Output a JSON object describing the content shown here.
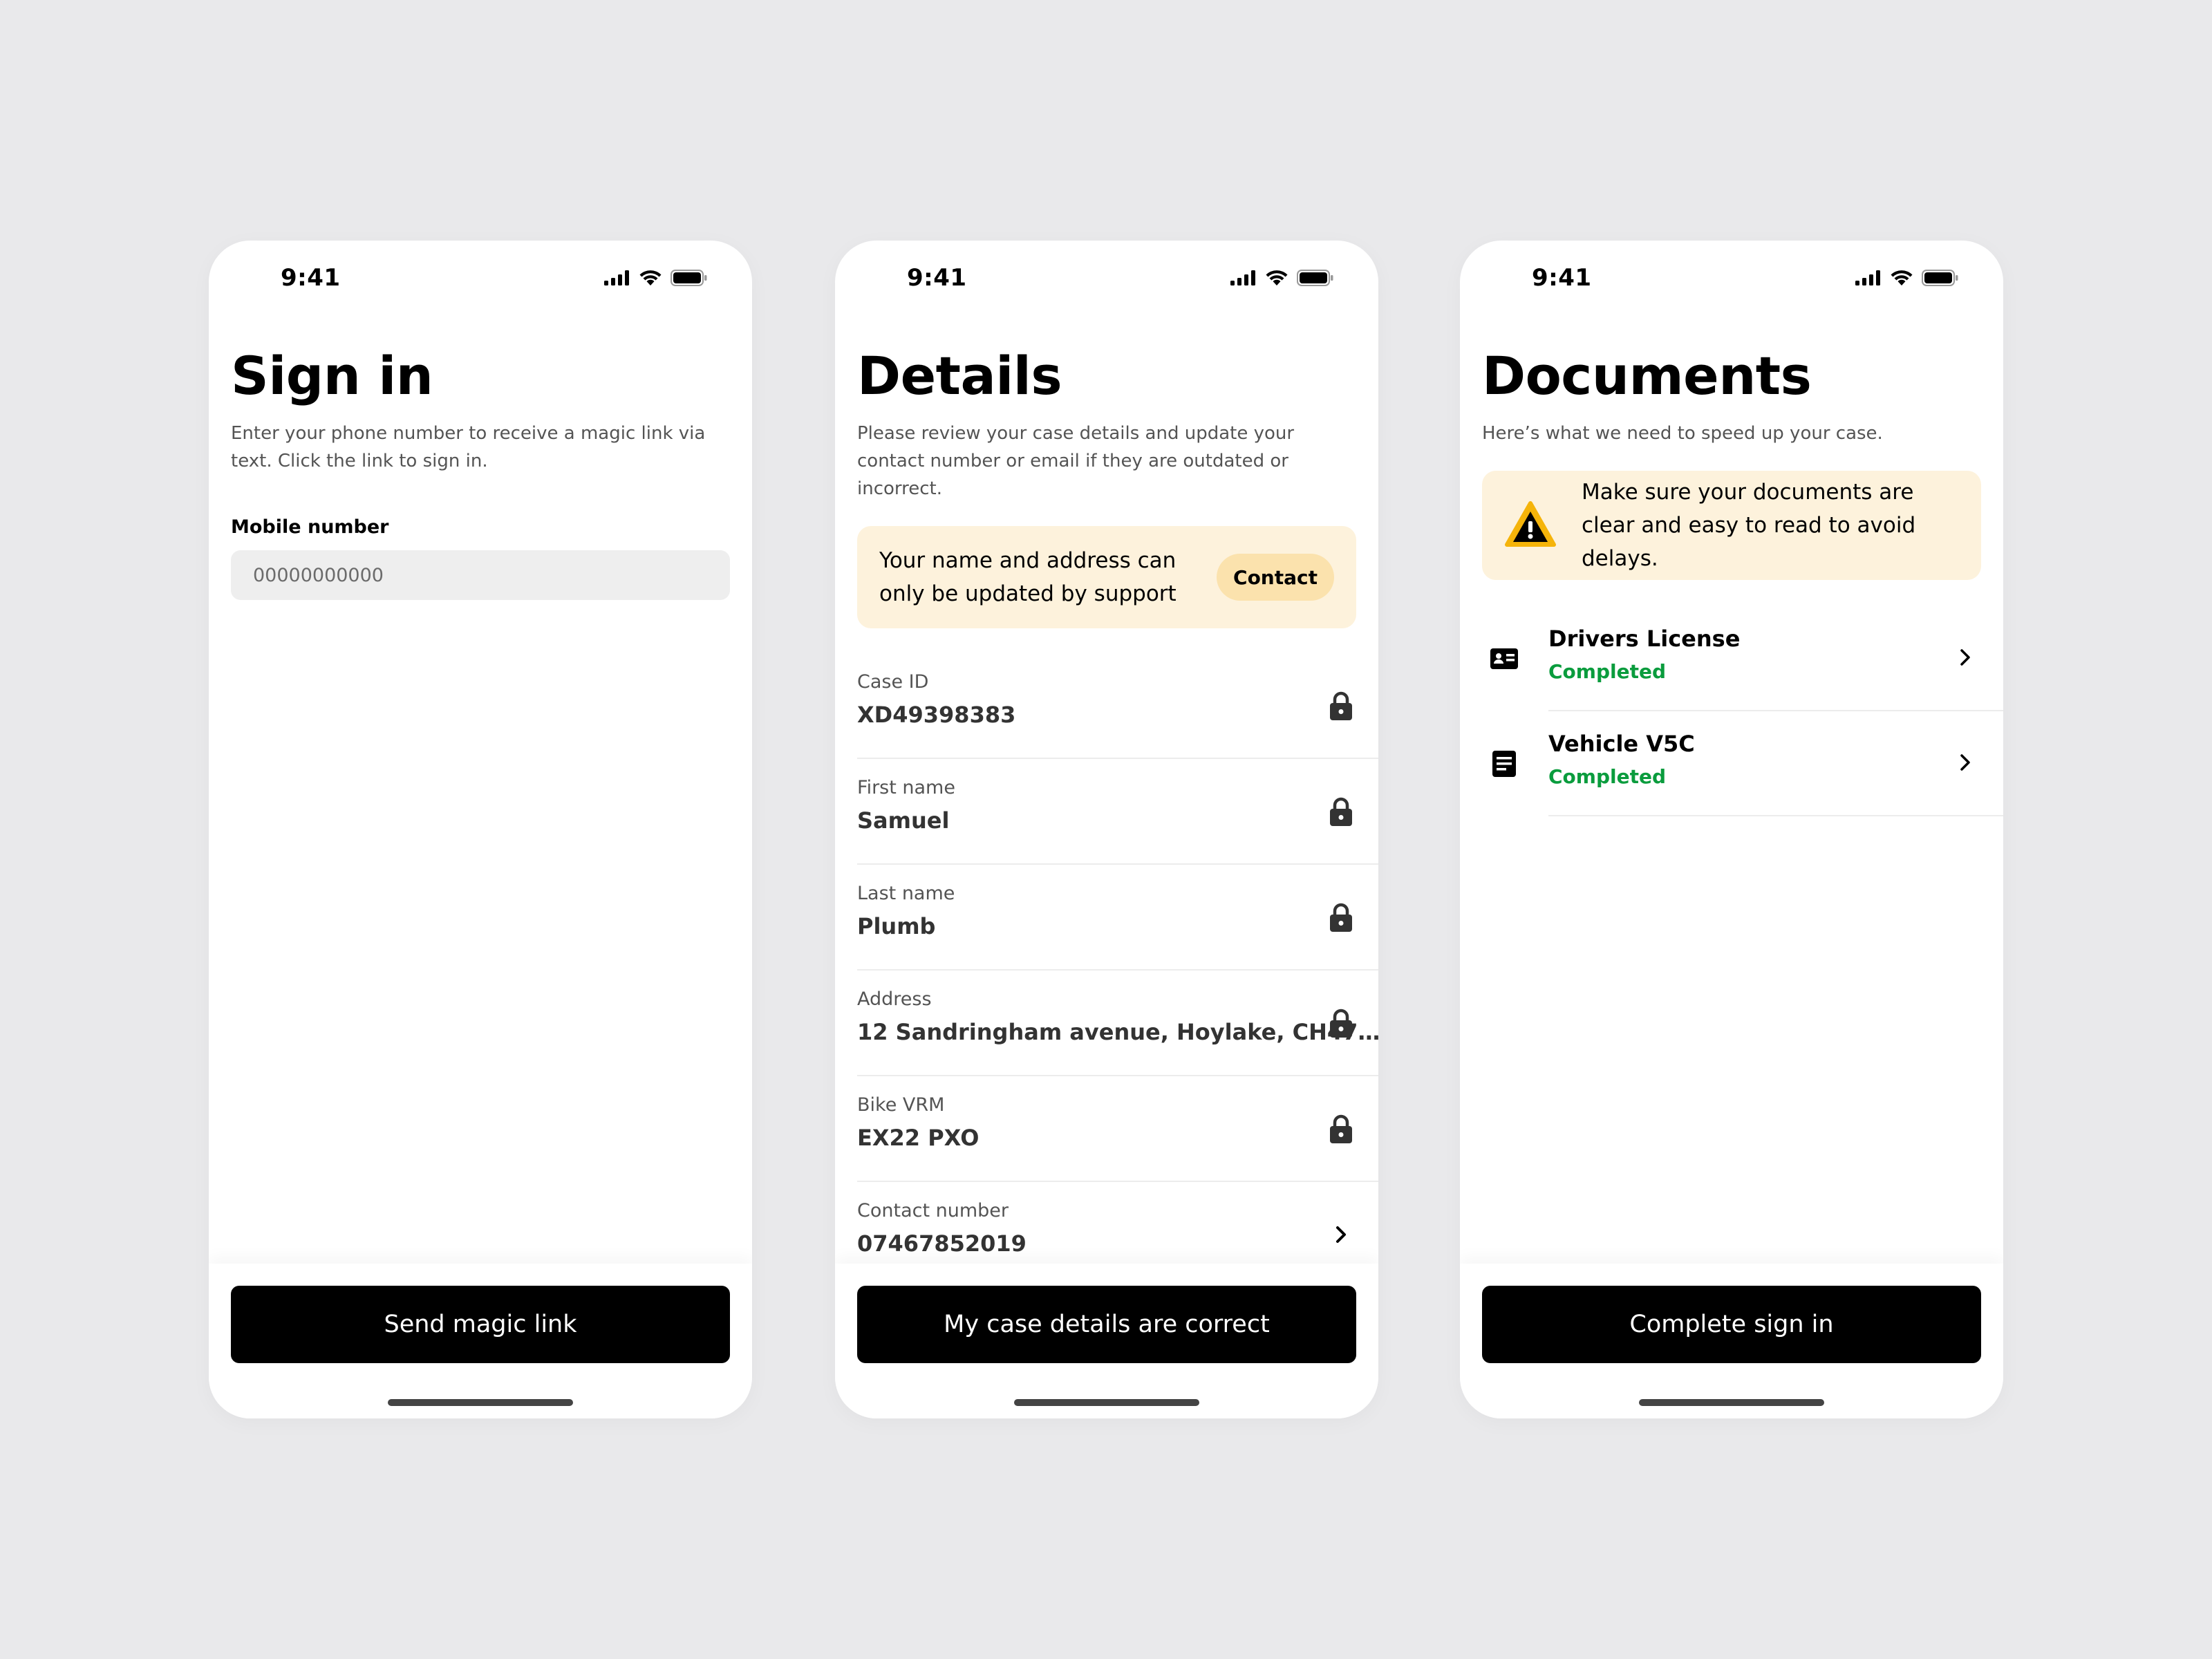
{
  "colors": {
    "background": "#e9e9eb",
    "banner": "#fdf2dc",
    "pill": "#fbe2ad",
    "primary_button": "#000000",
    "success": "#0a9c3d",
    "warning_icon": "#f5b40a"
  },
  "status_bar": {
    "time": "9:41",
    "icons": [
      "cellular-signal-icon",
      "wifi-icon",
      "battery-icon"
    ]
  },
  "signin": {
    "title": "Sign in",
    "subtitle": "Enter your phone number to receive a magic link via text. Click the link to sign in.",
    "mobile_label": "Mobile number",
    "mobile_placeholder": "00000000000",
    "button_label": "Send magic link"
  },
  "details": {
    "title": "Details",
    "subtitle": "Please review your case details and update your contact number or email if they are outdated or incorrect.",
    "banner_text": "Your name and address can only be updated by support",
    "contact_label": "Contact",
    "rows": [
      {
        "label": "Case ID",
        "value": "XD49398383",
        "icon": "lock-icon"
      },
      {
        "label": "First name",
        "value": "Samuel",
        "icon": "lock-icon"
      },
      {
        "label": "Last name",
        "value": "Plumb",
        "icon": "lock-icon"
      },
      {
        "label": "Address",
        "value": "12 Sandringham avenue, Hoylake, CH47…",
        "icon": "lock-icon"
      },
      {
        "label": "Bike VRM",
        "value": "EX22 PXO",
        "icon": "lock-icon"
      },
      {
        "label": "Contact number",
        "value": "07467852019",
        "icon": "chevron-right-icon"
      }
    ],
    "button_label": "My case details are correct"
  },
  "documents": {
    "title": "Documents",
    "subtitle": "Here’s what we need to speed up your case.",
    "warning_text": "Make sure your documents are clear and easy to read to avoid delays.",
    "items": [
      {
        "title": "Drivers License",
        "status": "Completed",
        "icon": "id-card-icon"
      },
      {
        "title": "Vehicle V5C",
        "status": "Completed",
        "icon": "document-icon"
      }
    ],
    "button_label": "Complete sign in"
  }
}
